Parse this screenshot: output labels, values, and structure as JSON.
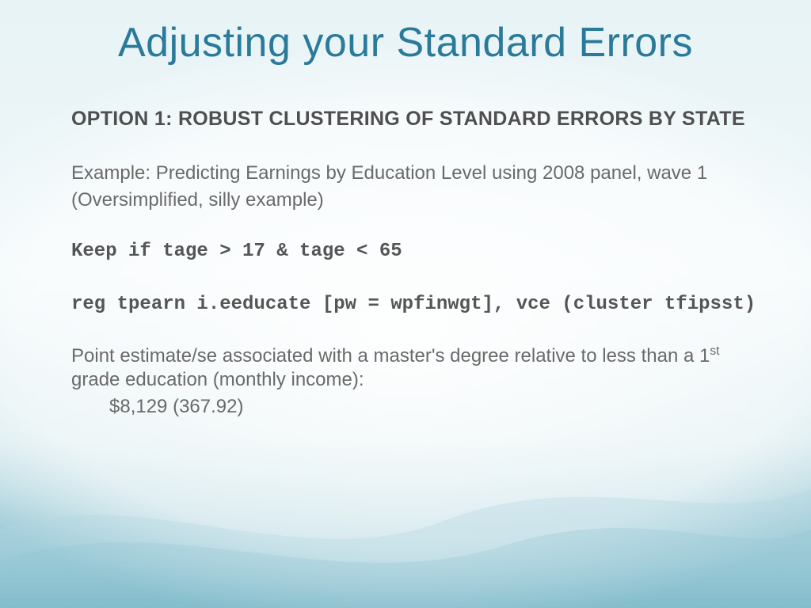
{
  "title": "Adjusting your Standard Errors",
  "option_header": "OPTION 1: ROBUST CLUSTERING OF STANDARD ERRORS BY STATE",
  "example_line": "Example: Predicting Earnings by Education Level using 2008 panel, wave 1",
  "example_note": "(Oversimplified, silly example)",
  "code1": "Keep if tage > 17 & tage < 65",
  "code2": "reg tpearn i.eeducate [pw = wpfinwgt], vce (cluster  tfipsst)",
  "result_intro_pre": "Point estimate/se associated with a master's degree relative to less than a 1",
  "result_intro_sup": "st",
  "result_intro_post": " grade education (monthly income):",
  "result_value": "$8,129 (367.92)"
}
